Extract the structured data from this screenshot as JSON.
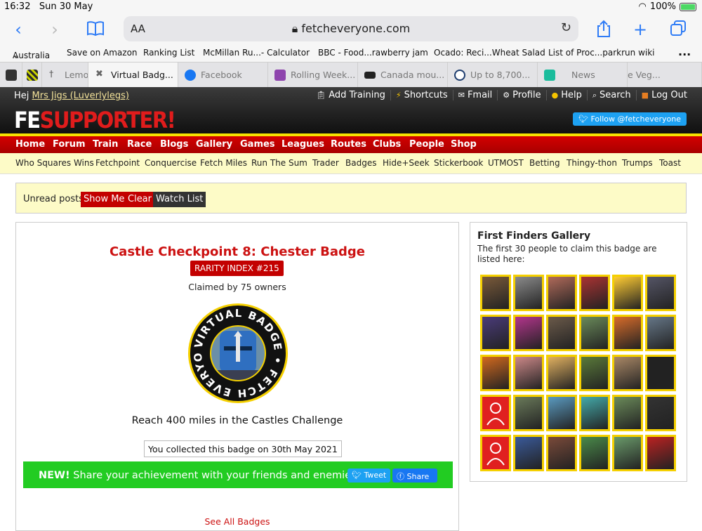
{
  "status": {
    "time": "16:32",
    "date": "Sun 30 May",
    "battery": "100%"
  },
  "browser": {
    "address_prefix": "AA",
    "url": "fetcheveryone.com",
    "bookmarks": [
      "Australia",
      "Save on Amazon",
      "Ranking List",
      "McMillan Ru...- Calculator",
      "BBC - Food...rawberry jam",
      "Ocado: Reci...Wheat Salad",
      "List of Proc...parkrun wiki"
    ],
    "tabs": [
      "Lemo",
      "Virtual Badg...",
      "Facebook",
      "Rolling Week...",
      "Canada mou...",
      "Up to 8,700...",
      "News",
      "e Veg..."
    ],
    "more_label": "..."
  },
  "site": {
    "greeting": "Hej",
    "user": "Mrs Jigs (Luverlylegs)",
    "top_links": [
      "Add Training",
      "Shortcuts",
      "Fmail",
      "Profile",
      "Help",
      "Search",
      "Log Out"
    ],
    "logo_fe": "FE",
    "logo_supporter": "SUPPORTER!",
    "follow": "Follow @fetcheveryone",
    "main_nav": [
      "Home",
      "Forum",
      "Train",
      "Race",
      "Blogs",
      "Gallery",
      "Games",
      "Leagues",
      "Routes",
      "Clubs",
      "People",
      "Shop"
    ],
    "sub_nav": [
      "Who Squares Wins",
      "Fetchpoint",
      "Conquercise",
      "Fetch Miles",
      "Run The Sum",
      "Trader",
      "Badges",
      "Hide+Seek",
      "Stickerbook",
      "UTMOST",
      "Betting",
      "Thingy-thon",
      "Trumps",
      "Toast"
    ]
  },
  "unread": {
    "label": "Unread posts",
    "show_me": "Show Me",
    "clear": "Clear",
    "watch_list": "Watch List"
  },
  "badge": {
    "title": "Castle Checkpoint 8: Chester Badge",
    "rarity": "RARITY INDEX #215",
    "claimed": "Claimed by 75 owners",
    "ring_text": "VIRTUAL BADGE • FETCH EVERYONE •",
    "description": "Reach 400 miles in the Castles Challenge",
    "collected": "You collected this badge on 30th May 2021",
    "share_new": "NEW!",
    "share_text": "Share your achievement with your friends and enemies:",
    "tweet": "Tweet",
    "share": "Share",
    "see_all": "See All Badges"
  },
  "gallery": {
    "title": "First Finders Gallery",
    "desc": "The first 30 people to claim this badge are listed here:"
  }
}
